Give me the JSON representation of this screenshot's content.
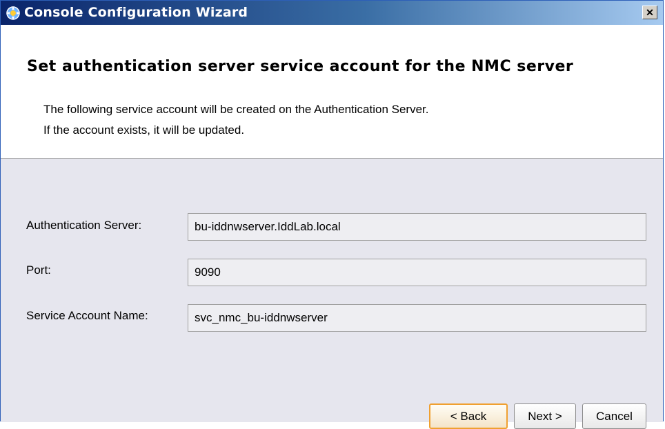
{
  "window": {
    "title": "Console Configuration Wizard",
    "close_glyph": "✕"
  },
  "header": {
    "title": "Set authentication server service account for the NMC server",
    "line1": "The following service account will be created on the Authentication Server.",
    "line2": "If the account exists, it will be updated."
  },
  "form": {
    "auth_server_label": "Authentication Server:",
    "auth_server_value": "bu-iddnwserver.IddLab.local",
    "port_label": "Port:",
    "port_value": "9090",
    "account_label": "Service Account Name:",
    "account_value": "svc_nmc_bu-iddnwserver"
  },
  "buttons": {
    "back": "< Back",
    "next": "Next >",
    "cancel": "Cancel"
  }
}
